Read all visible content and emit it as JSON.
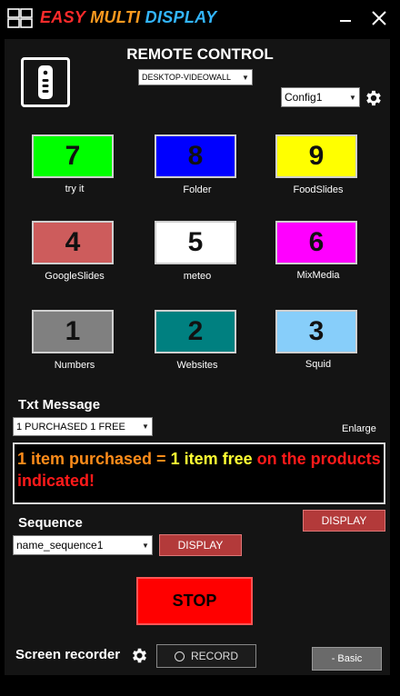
{
  "app": {
    "title_part1": "EASY ",
    "title_part2": "MULTI ",
    "title_part3": "DISPLAY"
  },
  "header": {
    "title": "REMOTE CONTROL",
    "device_select": "DESKTOP-VIDEOWALL",
    "config_select": "Config1"
  },
  "tiles": [
    {
      "number": "7",
      "label": "try it",
      "color": "#00ff00"
    },
    {
      "number": "8",
      "label": "Folder",
      "color": "#0000ff"
    },
    {
      "number": "9",
      "label": "FoodSlides",
      "color": "#ffff00"
    },
    {
      "number": "4",
      "label": "GoogleSlides",
      "color": "#cd5c5c"
    },
    {
      "number": "5",
      "label": "meteo",
      "color": "#ffffff"
    },
    {
      "number": "6",
      "label": "MixMedia",
      "color": "#ff00ff"
    },
    {
      "number": "1",
      "label": "Numbers",
      "color": "#808080"
    },
    {
      "number": "2",
      "label": "Websites",
      "color": "#008080"
    },
    {
      "number": "3",
      "label": "Squid",
      "color": "#87cefa"
    }
  ],
  "txt_message": {
    "label": "Txt Message",
    "select": "1 PURCHASED 1 FREE",
    "enlarge": "Enlarge",
    "segment1": "1 item purchased = ",
    "segment2": "1 item free ",
    "segment3": "on the products indicated!",
    "colors": {
      "segment1": "#ff8c1a",
      "segment2": "#ffff33",
      "segment3": "#ff1a1a"
    },
    "display_button": "DISPLAY"
  },
  "sequence": {
    "label": "Sequence",
    "select": "name_sequence1",
    "display_button": "DISPLAY"
  },
  "stop_button": "STOP",
  "recorder": {
    "label": "Screen recorder",
    "record_button": "RECORD"
  },
  "basic_button": "- Basic"
}
